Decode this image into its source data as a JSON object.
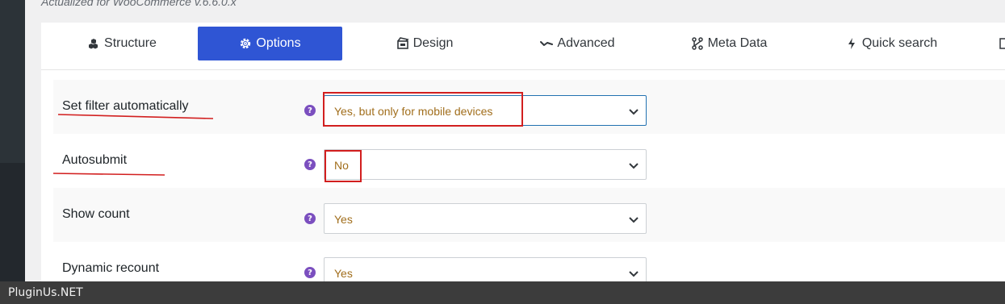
{
  "header": {
    "subtitle": "Actualized for WooCommerce v.6.6.0.x"
  },
  "tabs": [
    {
      "label": "Structure",
      "icon": "cubes-icon",
      "active": false
    },
    {
      "label": "Options",
      "icon": "gear-icon",
      "active": true
    },
    {
      "label": "Design",
      "icon": "design-icon",
      "active": false
    },
    {
      "label": "Advanced",
      "icon": "advanced-icon",
      "active": false
    },
    {
      "label": "Meta Data",
      "icon": "meta-data-icon",
      "active": false
    },
    {
      "label": "Quick search",
      "icon": "bolt-icon",
      "active": false
    }
  ],
  "options": [
    {
      "label": "Set filter automatically",
      "value": "Yes, but only for mobile devices"
    },
    {
      "label": "Autosubmit",
      "value": "No"
    },
    {
      "label": "Show count",
      "value": "Yes"
    },
    {
      "label": "Dynamic recount",
      "value": "Yes"
    }
  ],
  "footer": {
    "watermark": "PluginUs.NET"
  },
  "colors": {
    "accent": "#2f55d4",
    "annotation": "#d21f1f",
    "value_text": "#a16e1c",
    "help_icon": "#7b4fbf"
  }
}
